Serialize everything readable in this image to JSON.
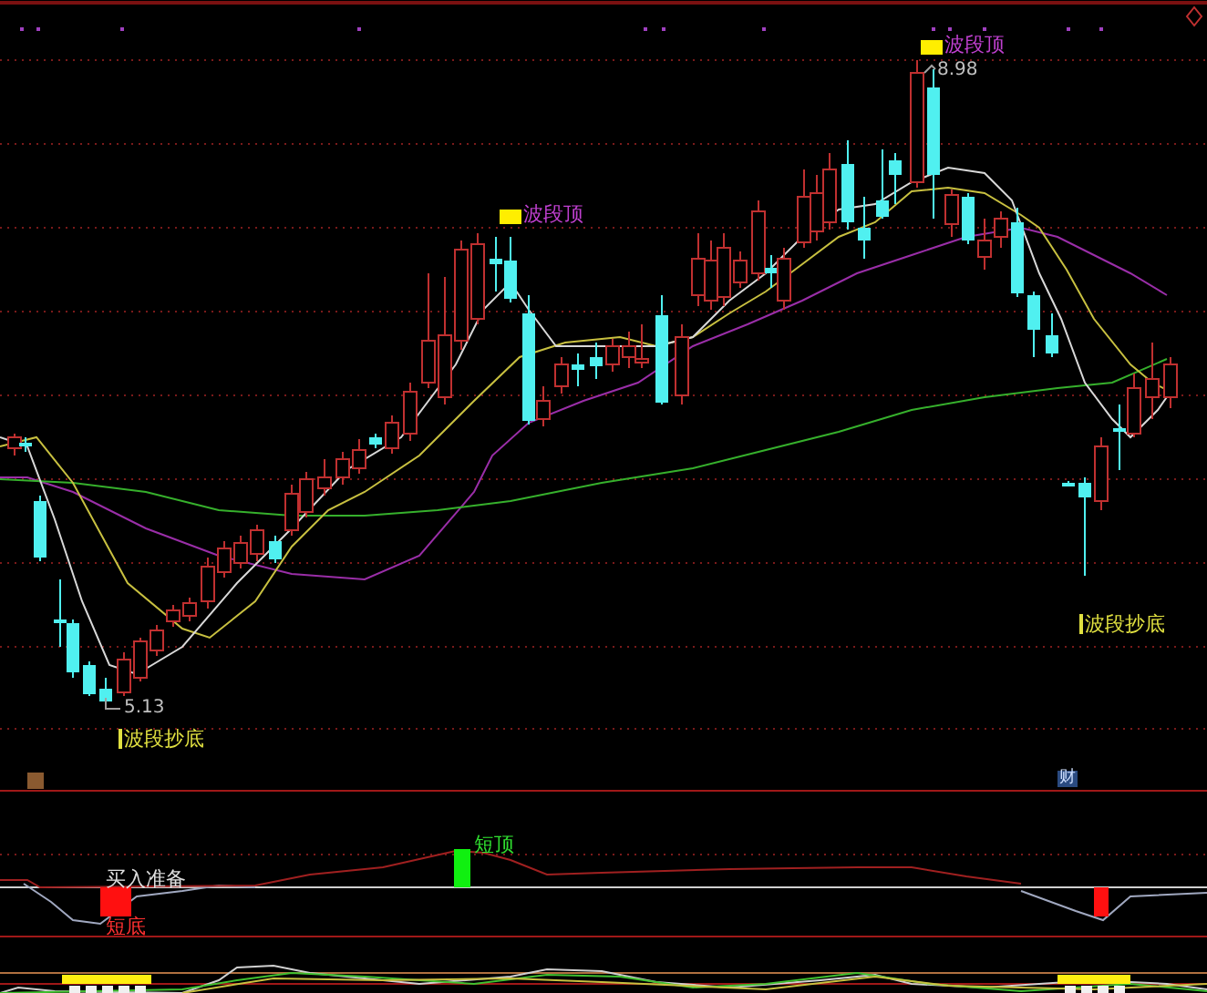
{
  "main_chart": {
    "annotations": [
      {
        "kind": "top",
        "label": "波段顶"
      },
      {
        "kind": "top",
        "label": "波段顶",
        "price": "8.98"
      },
      {
        "kind": "bottom",
        "label": "波段抄底",
        "price": "5.13"
      },
      {
        "kind": "bottom",
        "label": "波段抄底"
      }
    ],
    "badges": [
      {
        "label": "财"
      }
    ]
  },
  "signal_panel": {
    "labels": [
      {
        "kind": "buy",
        "text": "买入准备"
      },
      {
        "kind": "low",
        "text": "短底"
      },
      {
        "kind": "high",
        "text": "短顶"
      }
    ]
  }
}
